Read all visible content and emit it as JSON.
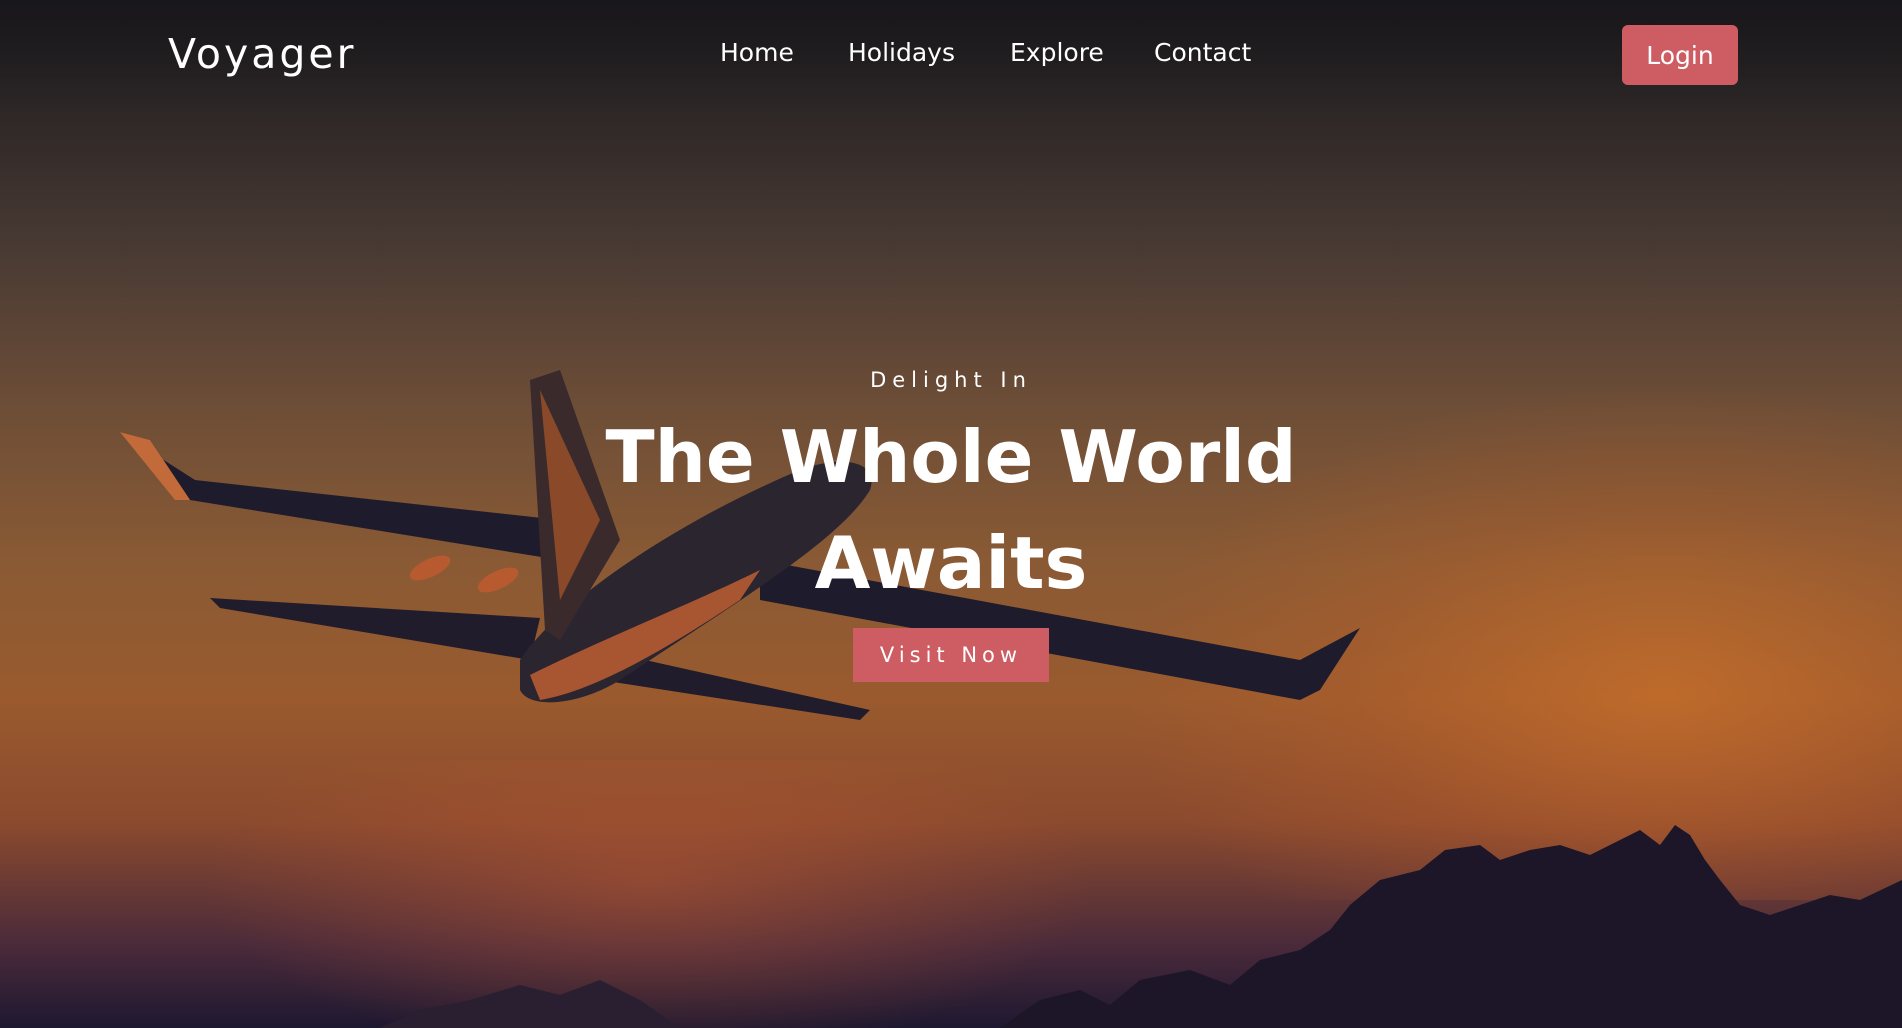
{
  "brand": {
    "logo_text": "Voyager"
  },
  "nav": {
    "items": [
      {
        "label": "Home"
      },
      {
        "label": "Holidays"
      },
      {
        "label": "Explore"
      },
      {
        "label": "Contact"
      }
    ],
    "login_label": "Login"
  },
  "hero": {
    "kicker": "Delight In",
    "headline_line1": "The Whole World",
    "headline_line2": "Awaits",
    "cta_label": "Visit Now",
    "background_image": "airplane-at-sunset-image"
  },
  "colors": {
    "accent": "#cd5d62",
    "text": "#ffffff"
  }
}
